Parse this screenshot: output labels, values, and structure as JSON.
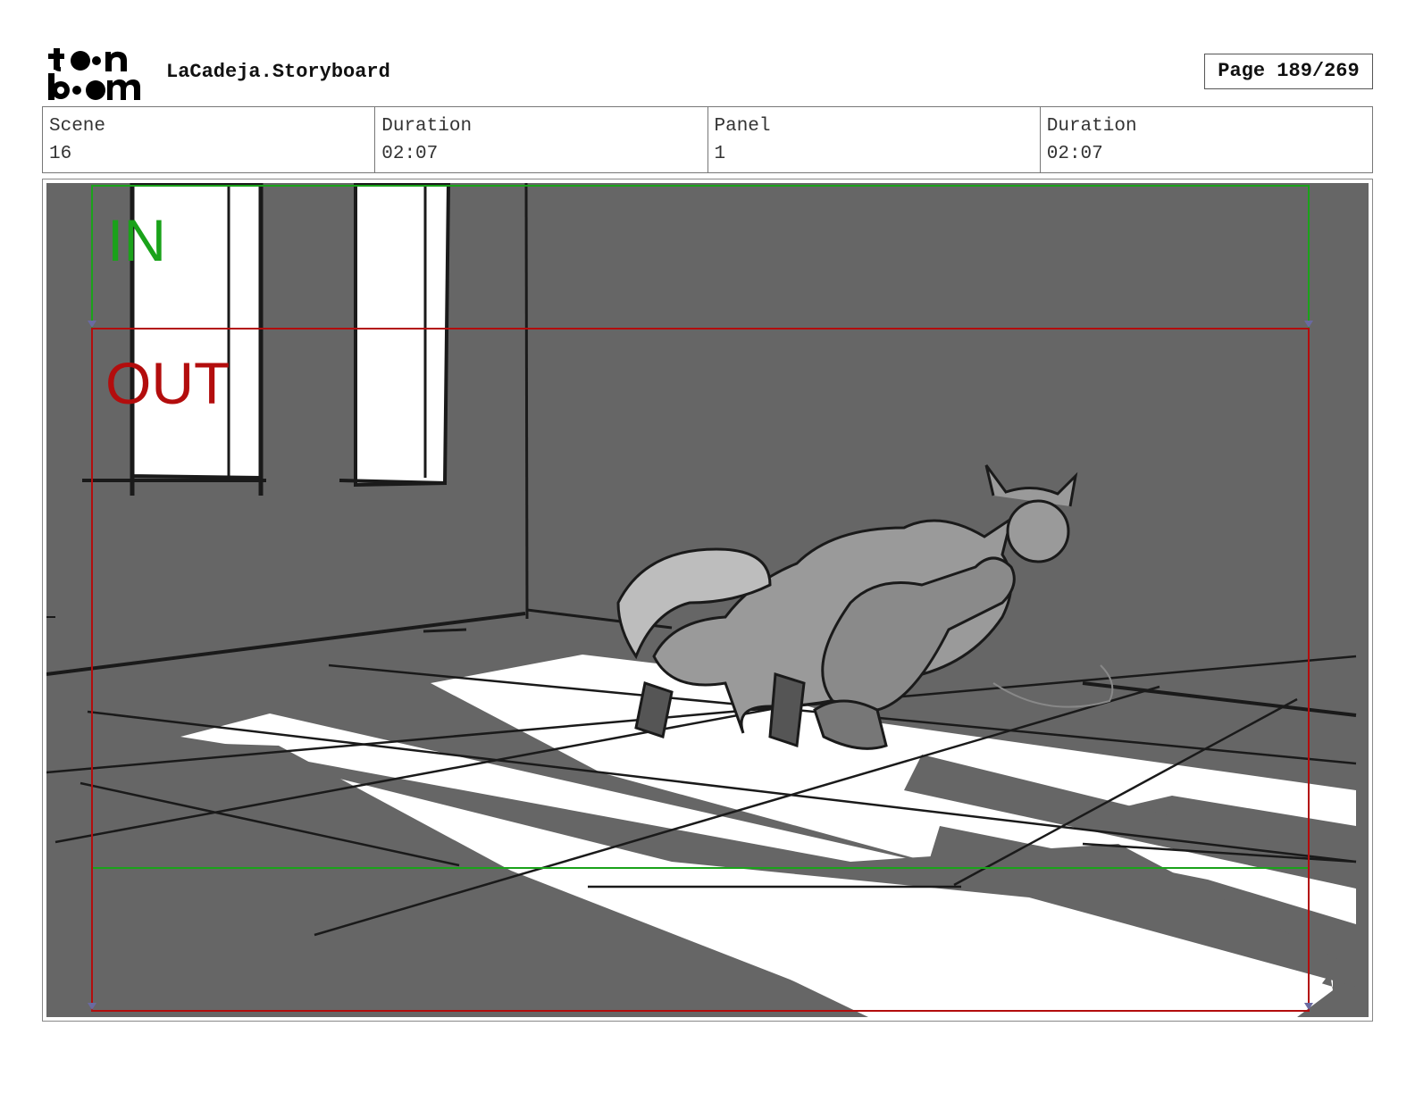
{
  "header": {
    "logo": {
      "text_top": "toon",
      "text_bottom": "boom",
      "icon": "toonboom-logo"
    },
    "title": "LaCadeja.Storyboard",
    "page_label": "Page 189/269"
  },
  "info_bar": [
    {
      "label": "Scene",
      "value": "16"
    },
    {
      "label": "Duration",
      "value": "02:07"
    },
    {
      "label": "Panel",
      "value": "1"
    },
    {
      "label": "Duration",
      "value": "02:07"
    }
  ],
  "panel": {
    "camera_in_label": "IN",
    "camera_out_label": "OUT",
    "colors": {
      "background": "#666666",
      "light": "#ffffff",
      "ink": "#1a1a1a",
      "camera_in": "#1aa21a",
      "camera_out": "#b30d0d"
    }
  }
}
